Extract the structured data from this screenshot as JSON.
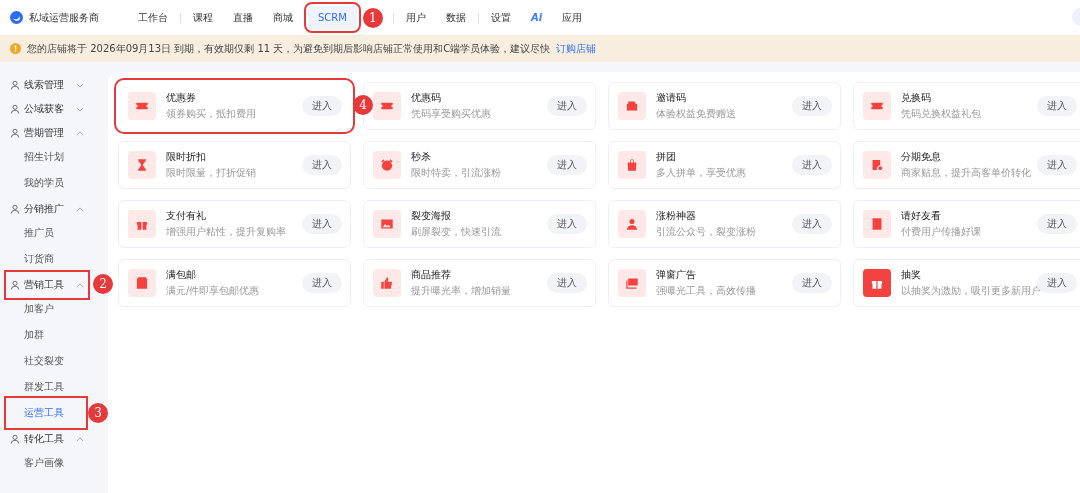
{
  "brand": {
    "name": "私域运营服务商"
  },
  "nav": [
    {
      "label": "工作台",
      "kind": "text",
      "selected": false,
      "divider": true
    },
    {
      "label": "课程",
      "kind": "text",
      "selected": false
    },
    {
      "label": "直播",
      "kind": "text",
      "selected": false
    },
    {
      "label": "商城",
      "kind": "text",
      "selected": false,
      "divider": true
    },
    {
      "label": "SCRM",
      "kind": "text",
      "selected": true,
      "divider": true,
      "marked": true,
      "callout": "1"
    },
    {
      "label": "用户",
      "kind": "text",
      "selected": false
    },
    {
      "label": "数据",
      "kind": "text",
      "selected": false,
      "divider": true
    },
    {
      "label": "设置",
      "kind": "text",
      "selected": false
    },
    {
      "label": "Ai",
      "kind": "ai",
      "selected": false
    },
    {
      "label": "应用",
      "kind": "text",
      "selected": false
    }
  ],
  "notice": {
    "text": "您的店铺将于 2026年09月13日 到期，有效期仅剩 11 天，为避免到期后影响店铺正常使用和C端学员体验，建议尽快",
    "link": "订购店铺"
  },
  "sidebar": [
    {
      "label": "线索管理",
      "expanded": false
    },
    {
      "label": "公域获客",
      "expanded": false
    },
    {
      "label": "营期管理",
      "expanded": true,
      "children": [
        {
          "label": "招生计划",
          "selected": false
        },
        {
          "label": "我的学员",
          "selected": false
        }
      ]
    },
    {
      "label": "分销推广",
      "expanded": true,
      "children": [
        {
          "label": "推广员",
          "selected": false
        },
        {
          "label": "订货商",
          "selected": false
        }
      ]
    },
    {
      "label": "营销工具",
      "expanded": true,
      "marked": true,
      "callout": "2",
      "children": [
        {
          "label": "加客户",
          "selected": false
        },
        {
          "label": "加群",
          "selected": false
        },
        {
          "label": "社交裂变",
          "selected": false
        },
        {
          "label": "群发工具",
          "selected": false
        },
        {
          "label": "运营工具",
          "selected": true,
          "marked": true,
          "callout": "3"
        }
      ]
    },
    {
      "label": "转化工具",
      "expanded": true,
      "children": [
        {
          "label": "客户画像",
          "selected": false
        }
      ]
    }
  ],
  "tools": [
    {
      "title": "优惠券",
      "desc": "领券购买，抵扣费用",
      "button": "进入",
      "kind": "tinted",
      "marked": true,
      "callout": "4"
    },
    {
      "title": "优惠码",
      "desc": "凭码享受购买优惠",
      "button": "进入",
      "kind": "tinted"
    },
    {
      "title": "邀请码",
      "desc": "体验权益免费赠送",
      "button": "进入",
      "kind": "tinted"
    },
    {
      "title": "兑换码",
      "desc": "凭码兑换权益礼包",
      "button": "进入",
      "kind": "tinted"
    },
    {
      "title": "限时折扣",
      "desc": "限时限量，打折促销",
      "button": "进入",
      "kind": "tinted"
    },
    {
      "title": "秒杀",
      "desc": "限时特卖，引流涨粉",
      "button": "进入",
      "kind": "tinted"
    },
    {
      "title": "拼团",
      "desc": "多人拼单，享受优惠",
      "button": "进入",
      "kind": "tinted"
    },
    {
      "title": "分期免息",
      "desc": "商家贴息，提升高客单价转化",
      "button": "进入",
      "kind": "tinted"
    },
    {
      "title": "支付有礼",
      "desc": "增强用户粘性，提升复购率",
      "button": "进入",
      "kind": "tinted"
    },
    {
      "title": "裂变海报",
      "desc": "刷屏裂变，快速引流",
      "button": "进入",
      "kind": "tinted"
    },
    {
      "title": "涨粉神器",
      "desc": "引流公众号，裂变涨粉",
      "button": "进入",
      "kind": "tinted"
    },
    {
      "title": "请好友看",
      "desc": "付费用户传播好课",
      "button": "进入",
      "kind": "tinted"
    },
    {
      "title": "满包邮",
      "desc": "满元/件即享包邮优惠",
      "button": "进入",
      "kind": "tinted"
    },
    {
      "title": "商品推荐",
      "desc": "提升曝光率，增加销量",
      "button": "进入",
      "kind": "tinted"
    },
    {
      "title": "弹窗广告",
      "desc": "强曝光工具，高效传播",
      "button": "进入",
      "kind": "tinted"
    },
    {
      "title": "抽奖",
      "desc": "以抽奖为激励，吸引更多新用户",
      "button": "进入",
      "kind": "solid"
    }
  ]
}
